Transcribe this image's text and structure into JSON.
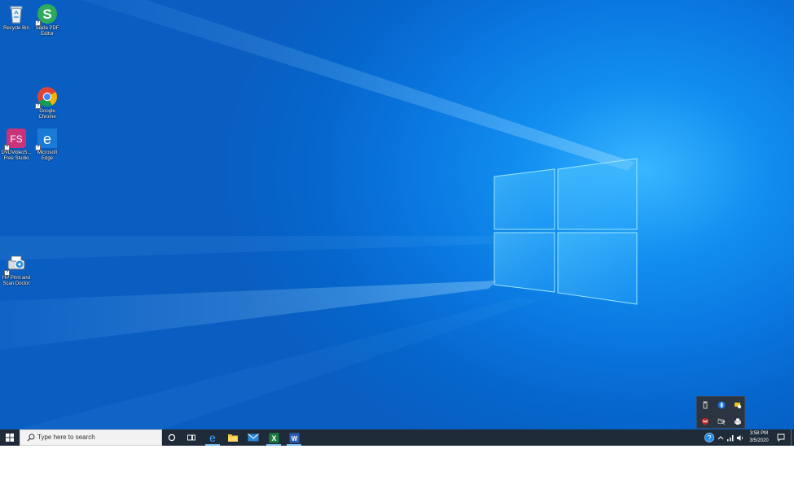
{
  "desktop": {
    "icons": [
      {
        "label": "Recycle Bin"
      },
      {
        "label": "Sejda PDF Editor"
      },
      {
        "label": "Google Chrome"
      },
      {
        "label": "DVDVideoS... Free Studio",
        "logo": "FS"
      },
      {
        "label": "Microsoft Edge"
      },
      {
        "label": "HP Print and Scan Doctor"
      }
    ]
  },
  "taskbar": {
    "search_placeholder": "Type here to search",
    "pinned": [
      "task-view-cortana",
      "task-view",
      "microsoft-edge",
      "file-explorer",
      "mail",
      "excel",
      "word"
    ],
    "excel_letter": "X",
    "word_letter": "W"
  },
  "tray": {
    "time": "3:58 PM",
    "date": "3/5/2020",
    "help_glyph": "?"
  },
  "colors": {
    "accent": "#0a77e0",
    "taskbar": "#1f2b38",
    "excel": "#1d7a42",
    "word": "#2b5eb7"
  }
}
